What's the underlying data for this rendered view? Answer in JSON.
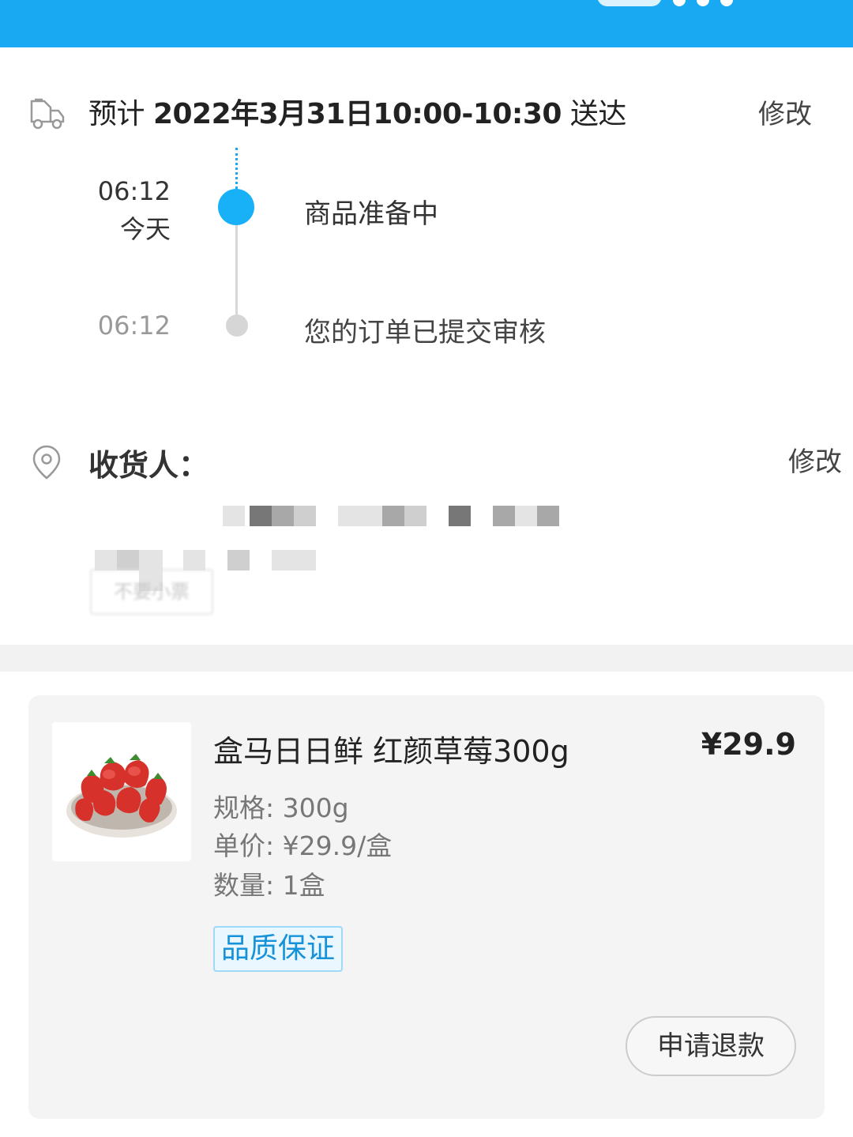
{
  "delivery": {
    "eta_prefix": "预计 ",
    "eta_time": "2022年3月31日10:00-10:30",
    "eta_suffix": " 送达",
    "edit_label": "修改"
  },
  "timeline": [
    {
      "time": "06:12",
      "day": "今天",
      "message": "商品准备中",
      "active": true
    },
    {
      "time": "06:12",
      "day": "",
      "message": "您的订单已提交审核",
      "active": false
    }
  ],
  "address": {
    "receiver_label": "收货人：",
    "edit_label": "修改",
    "tag_label": "不要小票"
  },
  "order_item": {
    "title": "盒马日日鲜 红颜草莓300g",
    "price": "¥29.9",
    "spec": "规格: 300g",
    "unit_price": "单价: ¥29.9/盒",
    "quantity": "数量: 1盒",
    "badge": "品质保证",
    "refund_label": "申请退款"
  },
  "colors": {
    "accent": "#18a9f2",
    "badge_text": "#1592d8"
  }
}
